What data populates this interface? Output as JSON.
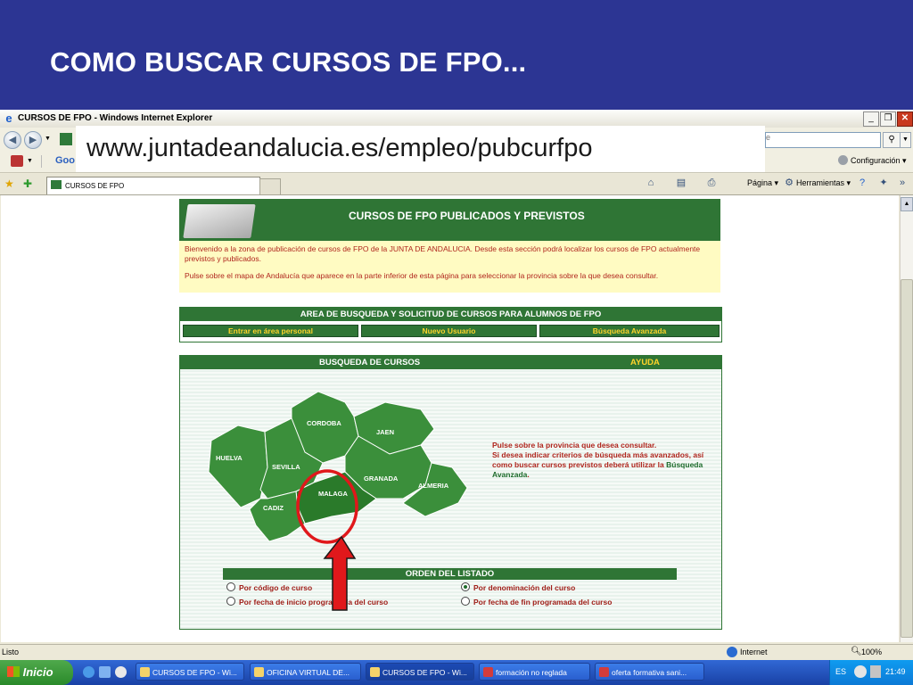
{
  "slide": {
    "title": "COMO BUSCAR CURSOS DE FPO..."
  },
  "browser": {
    "window_title": "CURSOS DE FPO - Windows Internet Explorer",
    "url_banner": "www.juntadeandalucia.es/empleo/pubcurfpo",
    "search_placeholder": "e",
    "links_partial": "Goo",
    "configuracion": "Configuración",
    "tab_title": "CURSOS DE FPO",
    "commands": {
      "pagina": "Página",
      "herramientas": "Herramientas"
    },
    "status_left": "Listo",
    "status_zone": "Internet",
    "zoom": "100%"
  },
  "page": {
    "header_title": "CURSOS DE FPO PUBLICADOS Y PREVISTOS",
    "intro_p1": "Bienvenido a la zona de publicación de cursos de FPO de la JUNTA DE ANDALUCIA. Desde esta sección podrá localizar los cursos de FPO actualmente previstos y publicados.",
    "intro_p2": "Pulse sobre el mapa de Andalucía que aparece en la parte inferior de esta página para seleccionar la provincia sobre la que desea consultar.",
    "area_title": "AREA DE BUSQUEDA Y SOLICITUD DE CURSOS PARA ALUMNOS DE FPO",
    "area_buttons": [
      "Entrar en área personal",
      "Nuevo Usuario",
      "Búsqueda Avanzada"
    ],
    "busqueda_title": "BUSQUEDA DE CURSOS",
    "ayuda": "AYUDA",
    "provinces": [
      "CORDOBA",
      "JAEN",
      "HUELVA",
      "SEVILLA",
      "GRANADA",
      "ALMERIA",
      "MALAGA",
      "CADIZ"
    ],
    "map_help_1": "Pulse sobre la provincia que desea consultar.",
    "map_help_2": "Si desea indicar criterios de búsqueda más avanzados, así como buscar cursos previstos deberá utilizar la",
    "map_help_link": "Búsqueda Avanzada",
    "map_help_end": ".",
    "orden_title": "ORDEN DEL LISTADO",
    "orden_options": [
      "Por código de curso",
      "Por denominación del curso",
      "Por fecha de inicio programada del curso",
      "Por fecha de fin programada del curso"
    ],
    "orden_selected": 1
  },
  "taskbar": {
    "start": "Inicio",
    "tasks": [
      "CURSOS DE FPO - Wi...",
      "OFICINA VIRTUAL DE...",
      "CURSOS DE FPO - Wi...",
      "formación no reglada",
      "oferta formativa sani..."
    ],
    "lang": "ES",
    "clock": "21:49"
  },
  "colors": {
    "slide_bg": "#2c3593",
    "green": "#2f7535",
    "highlight_red": "#e0181b",
    "intro_bg": "#fffbc2"
  }
}
